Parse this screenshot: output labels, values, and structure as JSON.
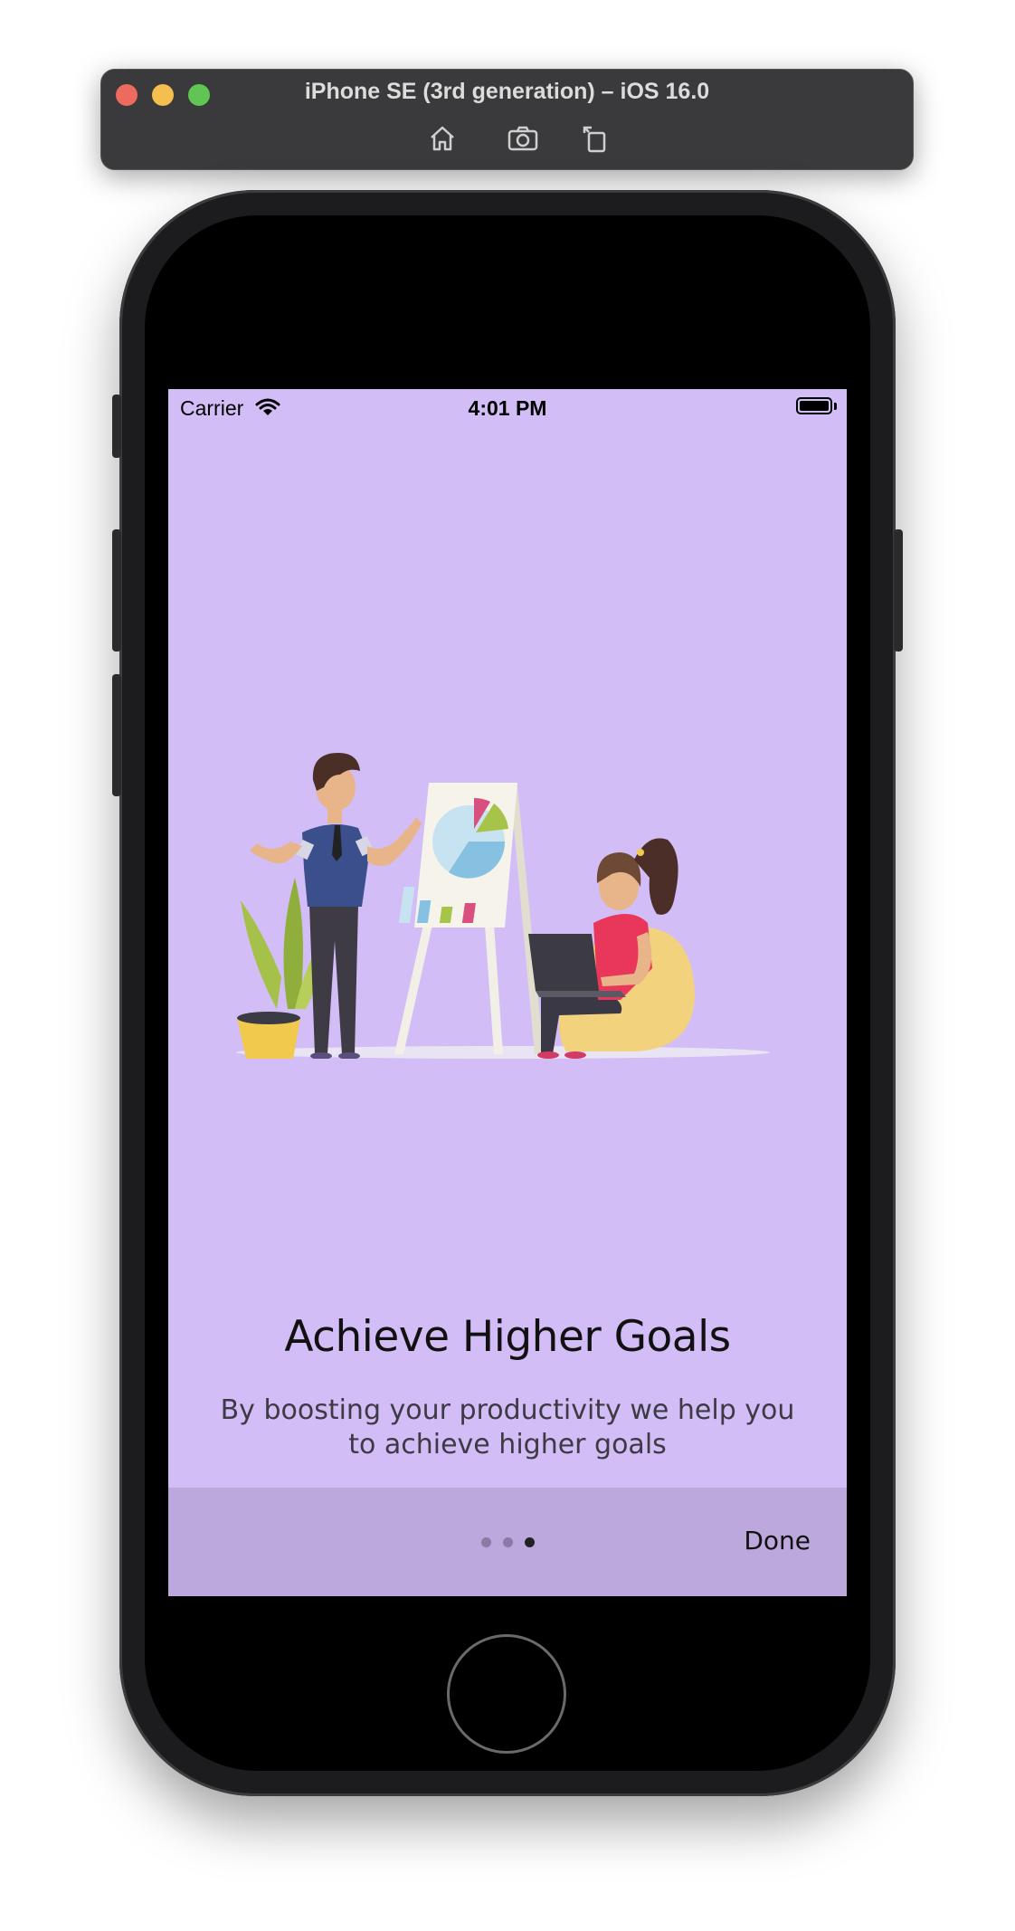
{
  "simulator": {
    "title": "iPhone SE (3rd generation) – iOS 16.0",
    "tools": [
      {
        "icon": "home-icon"
      },
      {
        "icon": "camera-icon"
      },
      {
        "icon": "rotate-icon"
      }
    ]
  },
  "status_bar": {
    "carrier": "Carrier",
    "time": "4:01 PM"
  },
  "onboarding": {
    "title": "Achieve Higher Goals",
    "subtitle": "By boosting your productivity we help you to achieve higher goals",
    "page_count": 3,
    "current_page": 3,
    "done_label": "Done",
    "background": "#d3bdf7",
    "footer_color": "#bca8dd"
  }
}
